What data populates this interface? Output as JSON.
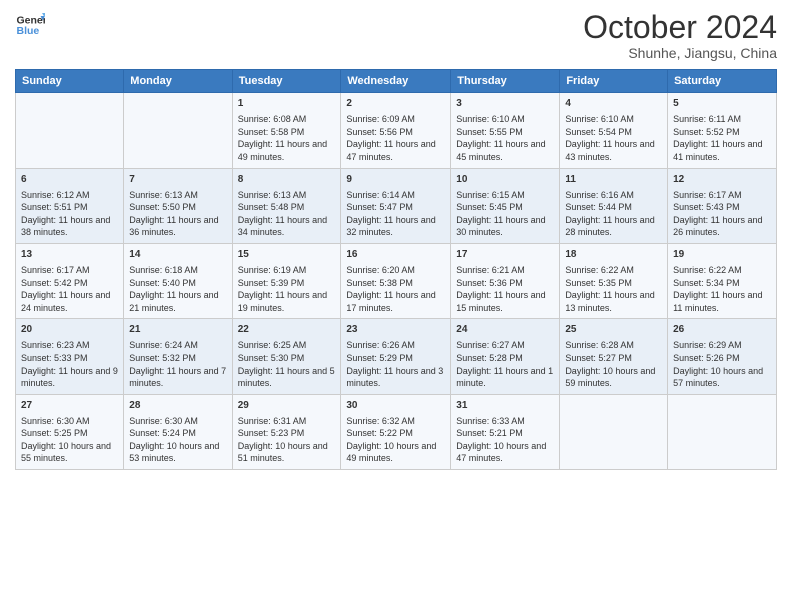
{
  "header": {
    "logo_line1": "General",
    "logo_line2": "Blue",
    "month": "October 2024",
    "location": "Shunhe, Jiangsu, China"
  },
  "weekdays": [
    "Sunday",
    "Monday",
    "Tuesday",
    "Wednesday",
    "Thursday",
    "Friday",
    "Saturday"
  ],
  "weeks": [
    [
      {
        "day": "",
        "info": ""
      },
      {
        "day": "",
        "info": ""
      },
      {
        "day": "1",
        "info": "Sunrise: 6:08 AM\nSunset: 5:58 PM\nDaylight: 11 hours and 49 minutes."
      },
      {
        "day": "2",
        "info": "Sunrise: 6:09 AM\nSunset: 5:56 PM\nDaylight: 11 hours and 47 minutes."
      },
      {
        "day": "3",
        "info": "Sunrise: 6:10 AM\nSunset: 5:55 PM\nDaylight: 11 hours and 45 minutes."
      },
      {
        "day": "4",
        "info": "Sunrise: 6:10 AM\nSunset: 5:54 PM\nDaylight: 11 hours and 43 minutes."
      },
      {
        "day": "5",
        "info": "Sunrise: 6:11 AM\nSunset: 5:52 PM\nDaylight: 11 hours and 41 minutes."
      }
    ],
    [
      {
        "day": "6",
        "info": "Sunrise: 6:12 AM\nSunset: 5:51 PM\nDaylight: 11 hours and 38 minutes."
      },
      {
        "day": "7",
        "info": "Sunrise: 6:13 AM\nSunset: 5:50 PM\nDaylight: 11 hours and 36 minutes."
      },
      {
        "day": "8",
        "info": "Sunrise: 6:13 AM\nSunset: 5:48 PM\nDaylight: 11 hours and 34 minutes."
      },
      {
        "day": "9",
        "info": "Sunrise: 6:14 AM\nSunset: 5:47 PM\nDaylight: 11 hours and 32 minutes."
      },
      {
        "day": "10",
        "info": "Sunrise: 6:15 AM\nSunset: 5:45 PM\nDaylight: 11 hours and 30 minutes."
      },
      {
        "day": "11",
        "info": "Sunrise: 6:16 AM\nSunset: 5:44 PM\nDaylight: 11 hours and 28 minutes."
      },
      {
        "day": "12",
        "info": "Sunrise: 6:17 AM\nSunset: 5:43 PM\nDaylight: 11 hours and 26 minutes."
      }
    ],
    [
      {
        "day": "13",
        "info": "Sunrise: 6:17 AM\nSunset: 5:42 PM\nDaylight: 11 hours and 24 minutes."
      },
      {
        "day": "14",
        "info": "Sunrise: 6:18 AM\nSunset: 5:40 PM\nDaylight: 11 hours and 21 minutes."
      },
      {
        "day": "15",
        "info": "Sunrise: 6:19 AM\nSunset: 5:39 PM\nDaylight: 11 hours and 19 minutes."
      },
      {
        "day": "16",
        "info": "Sunrise: 6:20 AM\nSunset: 5:38 PM\nDaylight: 11 hours and 17 minutes."
      },
      {
        "day": "17",
        "info": "Sunrise: 6:21 AM\nSunset: 5:36 PM\nDaylight: 11 hours and 15 minutes."
      },
      {
        "day": "18",
        "info": "Sunrise: 6:22 AM\nSunset: 5:35 PM\nDaylight: 11 hours and 13 minutes."
      },
      {
        "day": "19",
        "info": "Sunrise: 6:22 AM\nSunset: 5:34 PM\nDaylight: 11 hours and 11 minutes."
      }
    ],
    [
      {
        "day": "20",
        "info": "Sunrise: 6:23 AM\nSunset: 5:33 PM\nDaylight: 11 hours and 9 minutes."
      },
      {
        "day": "21",
        "info": "Sunrise: 6:24 AM\nSunset: 5:32 PM\nDaylight: 11 hours and 7 minutes."
      },
      {
        "day": "22",
        "info": "Sunrise: 6:25 AM\nSunset: 5:30 PM\nDaylight: 11 hours and 5 minutes."
      },
      {
        "day": "23",
        "info": "Sunrise: 6:26 AM\nSunset: 5:29 PM\nDaylight: 11 hours and 3 minutes."
      },
      {
        "day": "24",
        "info": "Sunrise: 6:27 AM\nSunset: 5:28 PM\nDaylight: 11 hours and 1 minute."
      },
      {
        "day": "25",
        "info": "Sunrise: 6:28 AM\nSunset: 5:27 PM\nDaylight: 10 hours and 59 minutes."
      },
      {
        "day": "26",
        "info": "Sunrise: 6:29 AM\nSunset: 5:26 PM\nDaylight: 10 hours and 57 minutes."
      }
    ],
    [
      {
        "day": "27",
        "info": "Sunrise: 6:30 AM\nSunset: 5:25 PM\nDaylight: 10 hours and 55 minutes."
      },
      {
        "day": "28",
        "info": "Sunrise: 6:30 AM\nSunset: 5:24 PM\nDaylight: 10 hours and 53 minutes."
      },
      {
        "day": "29",
        "info": "Sunrise: 6:31 AM\nSunset: 5:23 PM\nDaylight: 10 hours and 51 minutes."
      },
      {
        "day": "30",
        "info": "Sunrise: 6:32 AM\nSunset: 5:22 PM\nDaylight: 10 hours and 49 minutes."
      },
      {
        "day": "31",
        "info": "Sunrise: 6:33 AM\nSunset: 5:21 PM\nDaylight: 10 hours and 47 minutes."
      },
      {
        "day": "",
        "info": ""
      },
      {
        "day": "",
        "info": ""
      }
    ]
  ]
}
